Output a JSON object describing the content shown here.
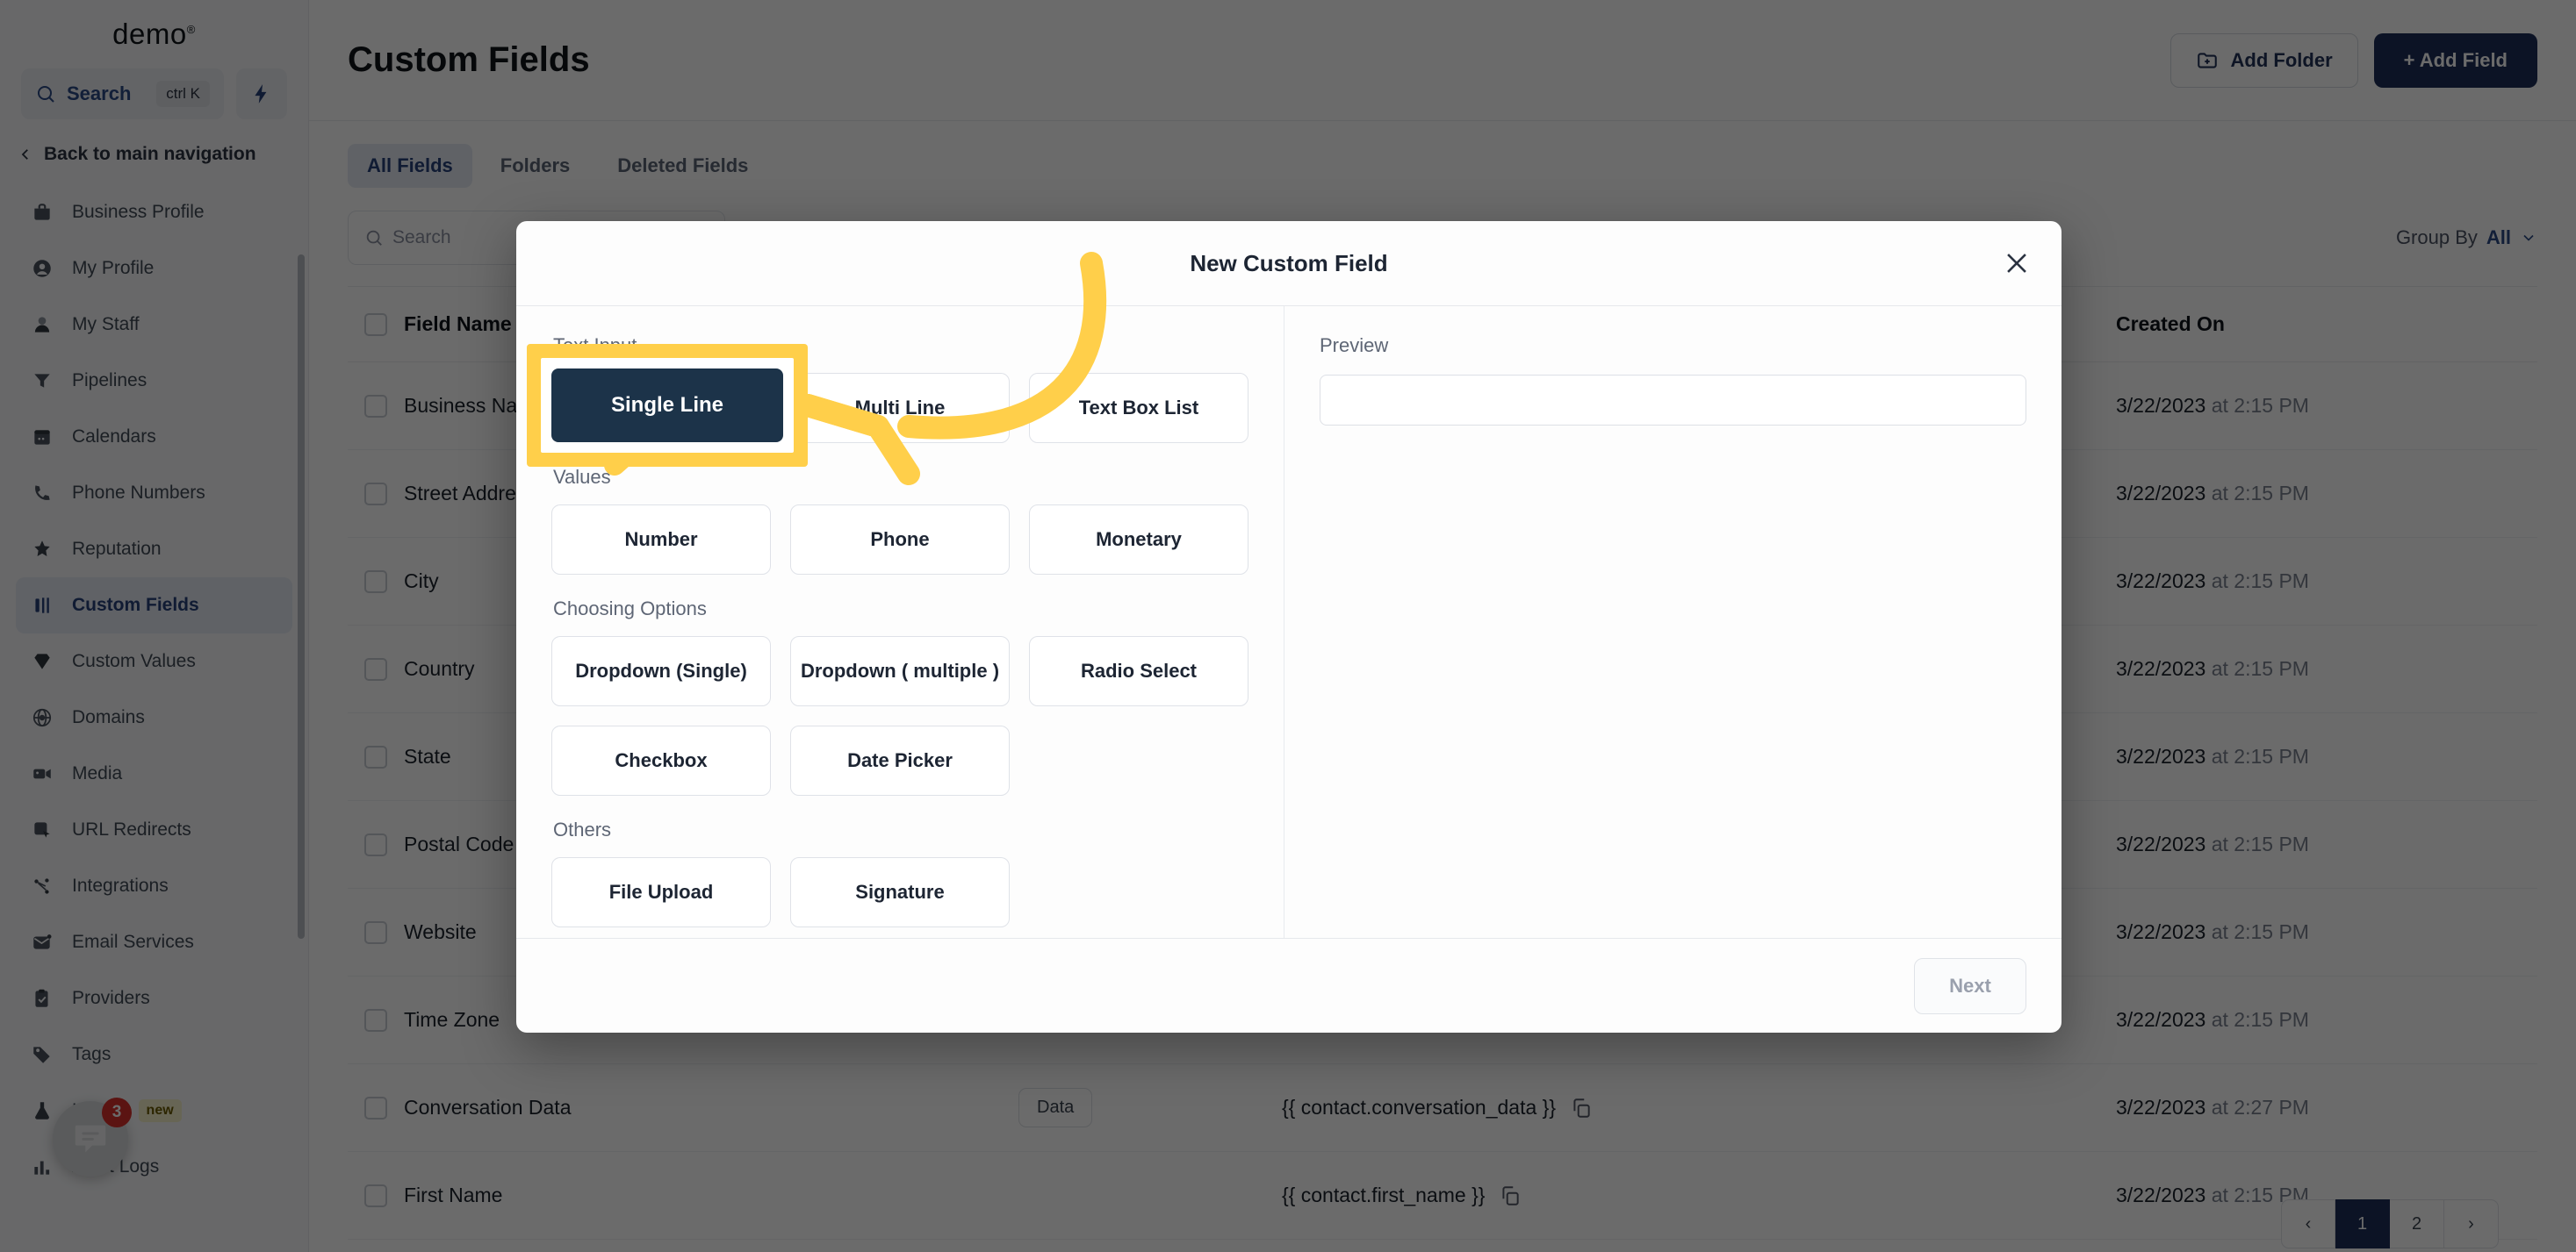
{
  "colors": {
    "accent_navy": "#1d2f58",
    "selected_navy": "#1c3349",
    "highlight_yellow": "#ffcf4a",
    "link_blue": "#27417a",
    "badge_red": "#d9302c"
  },
  "sidebar": {
    "brand": "demo",
    "brand_mark": "®",
    "search": {
      "label": "Search",
      "shortcut": "ctrl K"
    },
    "back_link": "Back to main navigation",
    "items": [
      {
        "label": "Business Profile",
        "icon": "briefcase-icon",
        "active": false
      },
      {
        "label": "My Profile",
        "icon": "user-circle-icon",
        "active": false
      },
      {
        "label": "My Staff",
        "icon": "person-icon",
        "active": false
      },
      {
        "label": "Pipelines",
        "icon": "funnel-icon",
        "active": false
      },
      {
        "label": "Calendars",
        "icon": "calendar-icon",
        "active": false
      },
      {
        "label": "Phone Numbers",
        "icon": "phone-icon",
        "active": false
      },
      {
        "label": "Reputation",
        "icon": "star-icon",
        "active": false
      },
      {
        "label": "Custom Fields",
        "icon": "fields-icon",
        "active": true
      },
      {
        "label": "Custom Values",
        "icon": "gem-icon",
        "active": false
      },
      {
        "label": "Domains",
        "icon": "globe-icon",
        "active": false
      },
      {
        "label": "Media",
        "icon": "video-icon",
        "active": false
      },
      {
        "label": "URL Redirects",
        "icon": "cursor-box-icon",
        "active": false
      },
      {
        "label": "Integrations",
        "icon": "share-nodes-icon",
        "active": false
      },
      {
        "label": "Email Services",
        "icon": "envelope-icon",
        "active": false
      },
      {
        "label": "Providers",
        "icon": "clipboard-check-icon",
        "active": false
      },
      {
        "label": "Tags",
        "icon": "tag-icon",
        "active": false
      },
      {
        "label": "Labs",
        "icon": "flask-icon",
        "active": false,
        "badge": "new"
      },
      {
        "label": "Audit Logs",
        "icon": "bar-chart-icon",
        "active": false
      }
    ],
    "chat_widget": {
      "badge": "3",
      "icon": "chat-bubble-icon"
    }
  },
  "header": {
    "title": "Custom Fields",
    "add_folder": "Add Folder",
    "add_field": "+ Add Field"
  },
  "tabs": [
    {
      "label": "All Fields",
      "active": true
    },
    {
      "label": "Folders",
      "active": false
    },
    {
      "label": "Deleted Fields",
      "active": false
    }
  ],
  "tools": {
    "search_placeholder": "Search",
    "group_by_label": "Group By",
    "group_by_value": "All"
  },
  "table": {
    "columns": [
      "Field Name",
      "",
      "",
      "Created On"
    ],
    "rows": [
      {
        "name": "Business Name",
        "type": "",
        "key": "",
        "date": "3/22/2023",
        "time": "at 2:15 PM"
      },
      {
        "name": "Street Address",
        "type": "",
        "key": "",
        "date": "3/22/2023",
        "time": "at 2:15 PM"
      },
      {
        "name": "City",
        "type": "",
        "key": "",
        "date": "3/22/2023",
        "time": "at 2:15 PM"
      },
      {
        "name": "Country",
        "type": "",
        "key": "",
        "date": "3/22/2023",
        "time": "at 2:15 PM"
      },
      {
        "name": "State",
        "type": "",
        "key": "",
        "date": "3/22/2023",
        "time": "at 2:15 PM"
      },
      {
        "name": "Postal Code",
        "type": "",
        "key": "",
        "date": "3/22/2023",
        "time": "at 2:15 PM"
      },
      {
        "name": "Website",
        "type": "",
        "key": "",
        "date": "3/22/2023",
        "time": "at 2:15 PM"
      },
      {
        "name": "Time Zone",
        "type": "",
        "key": "",
        "date": "3/22/2023",
        "time": "at 2:15 PM"
      },
      {
        "name": "Conversation Data",
        "type": "Data",
        "key": "{{ contact.conversation_data }}",
        "date": "3/22/2023",
        "time": "at 2:27 PM"
      },
      {
        "name": "First Name",
        "type": "",
        "key": "{{ contact.first_name }}",
        "date": "3/22/2023",
        "time": "at 2:15 PM"
      }
    ],
    "pagination": [
      "‹",
      "1",
      "2",
      "›"
    ]
  },
  "modal": {
    "title": "New Custom Field",
    "close_icon": "close-icon",
    "groups": [
      {
        "label": "Text Input",
        "buttons": [
          {
            "label": "Single Line",
            "selected": true
          },
          {
            "label": "Multi Line",
            "selected": false
          },
          {
            "label": "Text Box List",
            "selected": false
          }
        ]
      },
      {
        "label": "Values",
        "buttons": [
          {
            "label": "Number",
            "selected": false
          },
          {
            "label": "Phone",
            "selected": false
          },
          {
            "label": "Monetary",
            "selected": false
          }
        ]
      },
      {
        "label": "Choosing Options",
        "buttons": [
          {
            "label": "Dropdown (Single)",
            "selected": false
          },
          {
            "label": "Dropdown ( multiple )",
            "selected": false
          },
          {
            "label": "Radio Select",
            "selected": false
          },
          {
            "label": "Checkbox",
            "selected": false
          },
          {
            "label": "Date Picker",
            "selected": false
          }
        ]
      },
      {
        "label": "Others",
        "buttons": [
          {
            "label": "File Upload",
            "selected": false
          },
          {
            "label": "Signature",
            "selected": false
          }
        ]
      }
    ],
    "preview_label": "Preview",
    "next_label": "Next"
  },
  "annotation": {
    "highlighted_label": "Single Line",
    "arrow": "curved-arrow-left"
  }
}
